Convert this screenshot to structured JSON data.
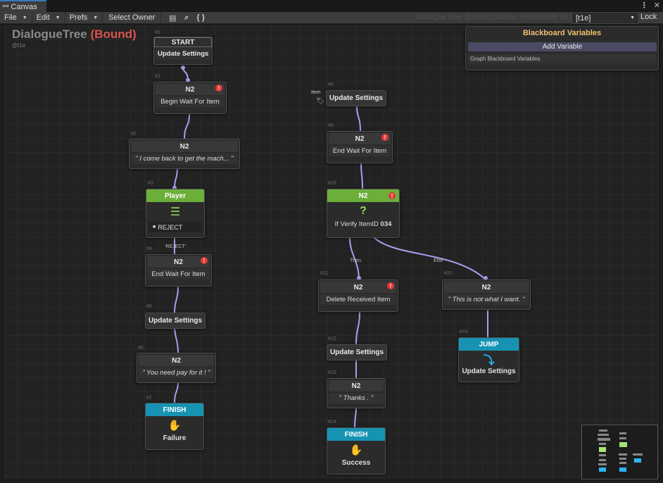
{
  "window": {
    "tab_title": "Canvas",
    "controls": [
      "⋮",
      "✕"
    ]
  },
  "toolbar": {
    "file": "File",
    "edit": "Edit",
    "prefs": "Prefs",
    "select_owner": "Select Owner",
    "framework": "DialogueTree @NodeCanvas Framework v3.21",
    "target": "[t1e]",
    "lock": "Lock"
  },
  "graph": {
    "name": "DialogueTree",
    "bound": "(Bound)",
    "owner": "@t1e"
  },
  "blackboard": {
    "title": "Blackboard Variables",
    "add_variable": "Add Variable",
    "subtitle": "Graph Blackboard Variables"
  },
  "nodes": {
    "n0": {
      "id": "#0",
      "head": "START",
      "body": "Update Settings"
    },
    "n1": {
      "id": "#1",
      "head": "N2",
      "body": "Begin Wait For Item"
    },
    "n2": {
      "id": "#2",
      "head": "N2",
      "body": "\" I come back to get the mach... \""
    },
    "n3": {
      "id": "#3",
      "head": "Player",
      "option": "REJECT"
    },
    "n4": {
      "id": "#4",
      "port_label": "'REJECT'",
      "head": "N2",
      "body": "End Wait For Item"
    },
    "n5": {
      "id": "#5",
      "body": "Update Settings"
    },
    "n6": {
      "id": "#6",
      "head": "N2",
      "body": "\" You need pay for it ! \""
    },
    "n7": {
      "id": "#7",
      "head": "FINISH",
      "body": "Failure"
    },
    "n8": {
      "id": "#8",
      "item_label": "Item",
      "body": "Update Settings"
    },
    "n9": {
      "id": "#9",
      "head": "N2",
      "body": "End Wait For Item"
    },
    "n10": {
      "id": "#10",
      "head": "N2",
      "body_prefix": "If Verify ItemID",
      "body_value": "034"
    },
    "n11": {
      "id": "#11",
      "port_label": "Then",
      "head": "N2",
      "body": "Delete Received Item"
    },
    "n12": {
      "id": "#12",
      "body": "Update Settings"
    },
    "n13": {
      "id": "#13",
      "head": "N2",
      "body": "\" Thanks . \""
    },
    "n14": {
      "id": "#14",
      "head": "FINISH",
      "body": "Success"
    },
    "n15": {
      "id": "#15",
      "port_label": "Else",
      "head": "N2",
      "body": "\" This is not what I want. \""
    },
    "n16": {
      "id": "#16",
      "head": "JUMP",
      "body": "Update Settings"
    }
  },
  "colors": {
    "wire": "#a8a0f0",
    "error": "#e53935",
    "green": "#6cae3a",
    "teal": "#1693b3",
    "bound": "#d9534f",
    "bb_title": "#f0c070"
  }
}
